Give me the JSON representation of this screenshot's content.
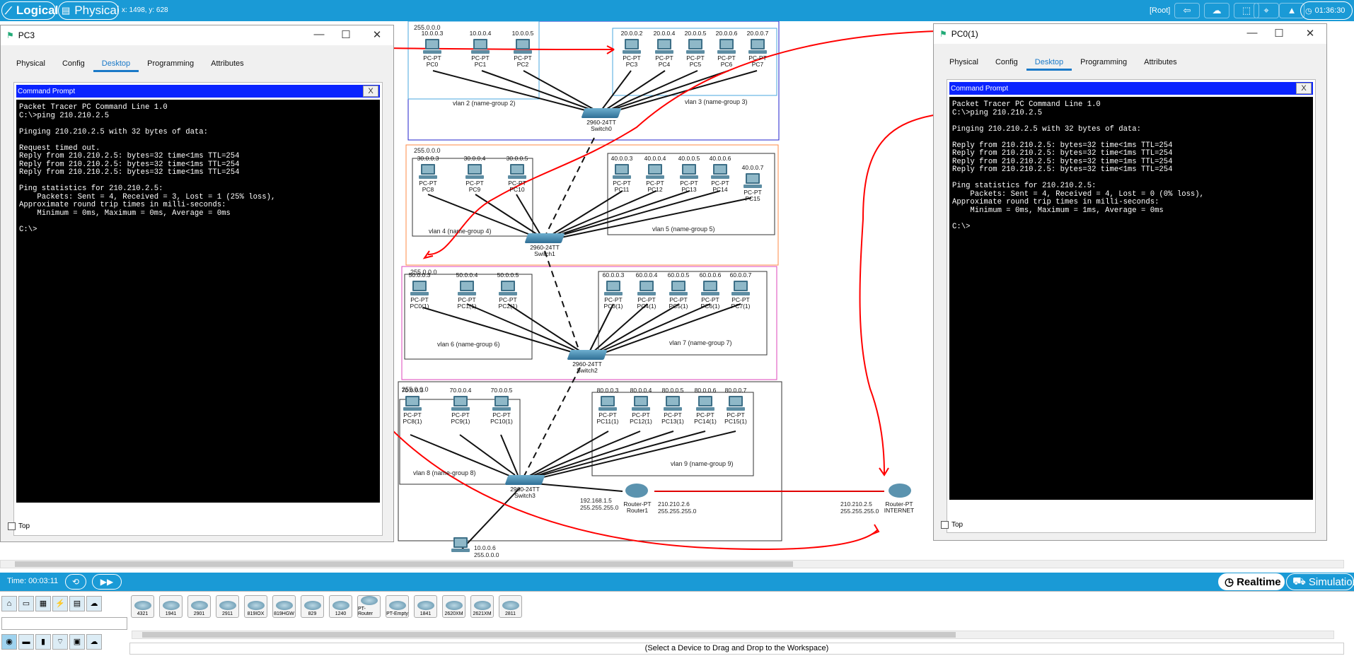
{
  "topbar": {
    "logical_label": "Logical",
    "physical_label": "Physical",
    "coords": "x: 1498, y: 628",
    "root_label": "[Root]",
    "clock": "01:36:30"
  },
  "workspace": {
    "areas": [
      {
        "mask": "255.0.0.0",
        "vlans": [
          "vlan 2 (name-group 2)",
          "vlan 3 (name-group 3)"
        ],
        "switch": {
          "model": "2960-24TT",
          "name": "Switch0"
        }
      },
      {
        "mask": "255.0.0.0",
        "vlans": [
          "vlan 4 (name-group 4)",
          "vlan 5 (name-group 5)"
        ],
        "switch": {
          "model": "2960-24TT",
          "name": "Switch1"
        }
      },
      {
        "mask": "255.0.0.0",
        "vlans": [
          "vlan 6 (name-group 6)",
          "vlan 7 (name-group 7)"
        ],
        "switch": {
          "model": "2960-24TT",
          "name": "Switch2"
        }
      },
      {
        "mask": "255.0.0.0",
        "vlans": [
          "vlan 8 (name-group 8)",
          "vlan 9 (name-group 9)"
        ],
        "switch": {
          "model": "2960-24TT",
          "name": "Switch3"
        }
      }
    ],
    "pcs": [
      {
        "ip": "10.0.0.3",
        "type": "PC-PT",
        "name": "PC0"
      },
      {
        "ip": "10.0.0.4",
        "type": "PC-PT",
        "name": "PC1"
      },
      {
        "ip": "10.0.0.5",
        "type": "PC-PT",
        "name": "PC2"
      },
      {
        "ip": "20.0.0.2",
        "type": "PC-PT",
        "name": "PC3"
      },
      {
        "ip": "20.0.0.4",
        "type": "PC-PT",
        "name": "PC4"
      },
      {
        "ip": "20.0.0.5",
        "type": "PC-PT",
        "name": "PC5"
      },
      {
        "ip": "20.0.0.6",
        "type": "PC-PT",
        "name": "PC6"
      },
      {
        "ip": "20.0.0.7",
        "type": "PC-PT",
        "name": "PC7"
      },
      {
        "ip": "30.0.0.3",
        "type": "PC-PT",
        "name": "PC8"
      },
      {
        "ip": "30.0.0.4",
        "type": "PC-PT",
        "name": "PC9"
      },
      {
        "ip": "30.0.0.5",
        "type": "PC-PT",
        "name": "PC10"
      },
      {
        "ip": "40.0.0.3",
        "type": "PC-PT",
        "name": "PC11"
      },
      {
        "ip": "40.0.0.4",
        "type": "PC-PT",
        "name": "PC12"
      },
      {
        "ip": "40.0.0.5",
        "type": "PC-PT",
        "name": "PC13"
      },
      {
        "ip": "40.0.0.6",
        "type": "PC-PT",
        "name": "PC14"
      },
      {
        "ip": "40.0.0.7",
        "type": "PC-PT",
        "name": "PC15"
      },
      {
        "ip": "50.0.0.3",
        "type": "PC-PT",
        "name": "PC0(1)"
      },
      {
        "ip": "50.0.0.4",
        "type": "PC-PT",
        "name": "PC1(1)"
      },
      {
        "ip": "50.0.0.5",
        "type": "PC-PT",
        "name": "PC2(1)"
      },
      {
        "ip": "60.0.0.3",
        "type": "PC-PT",
        "name": "PC3(1)"
      },
      {
        "ip": "60.0.0.4",
        "type": "PC-PT",
        "name": "PC4(1)"
      },
      {
        "ip": "60.0.0.5",
        "type": "PC-PT",
        "name": "PC5(1)"
      },
      {
        "ip": "60.0.0.6",
        "type": "PC-PT",
        "name": "PC6(1)"
      },
      {
        "ip": "60.0.0.7",
        "type": "PC-PT",
        "name": "PC7(1)"
      },
      {
        "ip": "70.0.0.3",
        "type": "PC-PT",
        "name": "PC8(1)"
      },
      {
        "ip": "70.0.0.4",
        "type": "PC-PT",
        "name": "PC9(1)"
      },
      {
        "ip": "70.0.0.5",
        "type": "PC-PT",
        "name": "PC10(1)"
      },
      {
        "ip": "80.0.0.3",
        "type": "PC-PT",
        "name": "PC11(1)"
      },
      {
        "ip": "80.0.0.4",
        "type": "PC-PT",
        "name": "PC12(1)"
      },
      {
        "ip": "80.0.0.5",
        "type": "PC-PT",
        "name": "PC13(1)"
      },
      {
        "ip": "80.0.0.6",
        "type": "PC-PT",
        "name": "PC14(1)"
      },
      {
        "ip": "80.0.0.7",
        "type": "PC-PT",
        "name": "PC15(1)"
      }
    ],
    "router1": {
      "type": "Router-PT",
      "name": "Router1",
      "left_ip": "192.168.1.5",
      "left_mask": "255.255.255.0",
      "right_ip": "210.210.2.6",
      "right_mask": "255.255.255.0"
    },
    "internet": {
      "type": "Router-PT",
      "name": "INTERNET",
      "ip": "210.210.2.5",
      "mask": "255.255.255.0"
    },
    "bottom_pc": {
      "ip": "10.0.0.6",
      "mask": "255.0.0.0"
    }
  },
  "pc3_window": {
    "title": "PC3",
    "tabs": [
      "Physical",
      "Config",
      "Desktop",
      "Programming",
      "Attributes"
    ],
    "active_tab": "Desktop",
    "panel_title": "Command Prompt",
    "close_label": "X",
    "terminal": "Packet Tracer PC Command Line 1.0\nC:\\>ping 210.210.2.5\n\nPinging 210.210.2.5 with 32 bytes of data:\n\nRequest timed out.\nReply from 210.210.2.5: bytes=32 time<1ms TTL=254\nReply from 210.210.2.5: bytes=32 time<1ms TTL=254\nReply from 210.210.2.5: bytes=32 time<1ms TTL=254\n\nPing statistics for 210.210.2.5:\n    Packets: Sent = 4, Received = 3, Lost = 1 (25% loss),\nApproximate round trip times in milli-seconds:\n    Minimum = 0ms, Maximum = 0ms, Average = 0ms\n\nC:\\>",
    "top_label": "Top"
  },
  "pc0_window": {
    "title": "PC0(1)",
    "tabs": [
      "Physical",
      "Config",
      "Desktop",
      "Programming",
      "Attributes"
    ],
    "active_tab": "Desktop",
    "panel_title": "Command Prompt",
    "close_label": "X",
    "terminal": "Packet Tracer PC Command Line 1.0\nC:\\>ping 210.210.2.5\n\nPinging 210.210.2.5 with 32 bytes of data:\n\nReply from 210.210.2.5: bytes=32 time<1ms TTL=254\nReply from 210.210.2.5: bytes=32 time<1ms TTL=254\nReply from 210.210.2.5: bytes=32 time=1ms TTL=254\nReply from 210.210.2.5: bytes=32 time<1ms TTL=254\n\nPing statistics for 210.210.2.5:\n    Packets: Sent = 4, Received = 4, Lost = 0 (0% loss),\nApproximate round trip times in milli-seconds:\n    Minimum = 0ms, Maximum = 1ms, Average = 0ms\n\nC:\\>",
    "top_label": "Top"
  },
  "bottombar": {
    "time": "Time: 00:03:11",
    "realtime_label": "Realtime",
    "simulation_label": "Simulation"
  },
  "palette": {
    "models": [
      "4321",
      "1941",
      "2901",
      "2911",
      "819IOX",
      "819HGW",
      "829",
      "1240",
      "PT-Router",
      "PT-Empty",
      "1841",
      "2620XM",
      "2621XM",
      "2811"
    ],
    "status": "(Select a Device to Drag and Drop to the Workspace)"
  },
  "colors": {
    "accent": "#1a9ad6",
    "link_green": "#2db35d",
    "annotation_red": "#ff0000",
    "cmd_header": "#0a23ff"
  }
}
